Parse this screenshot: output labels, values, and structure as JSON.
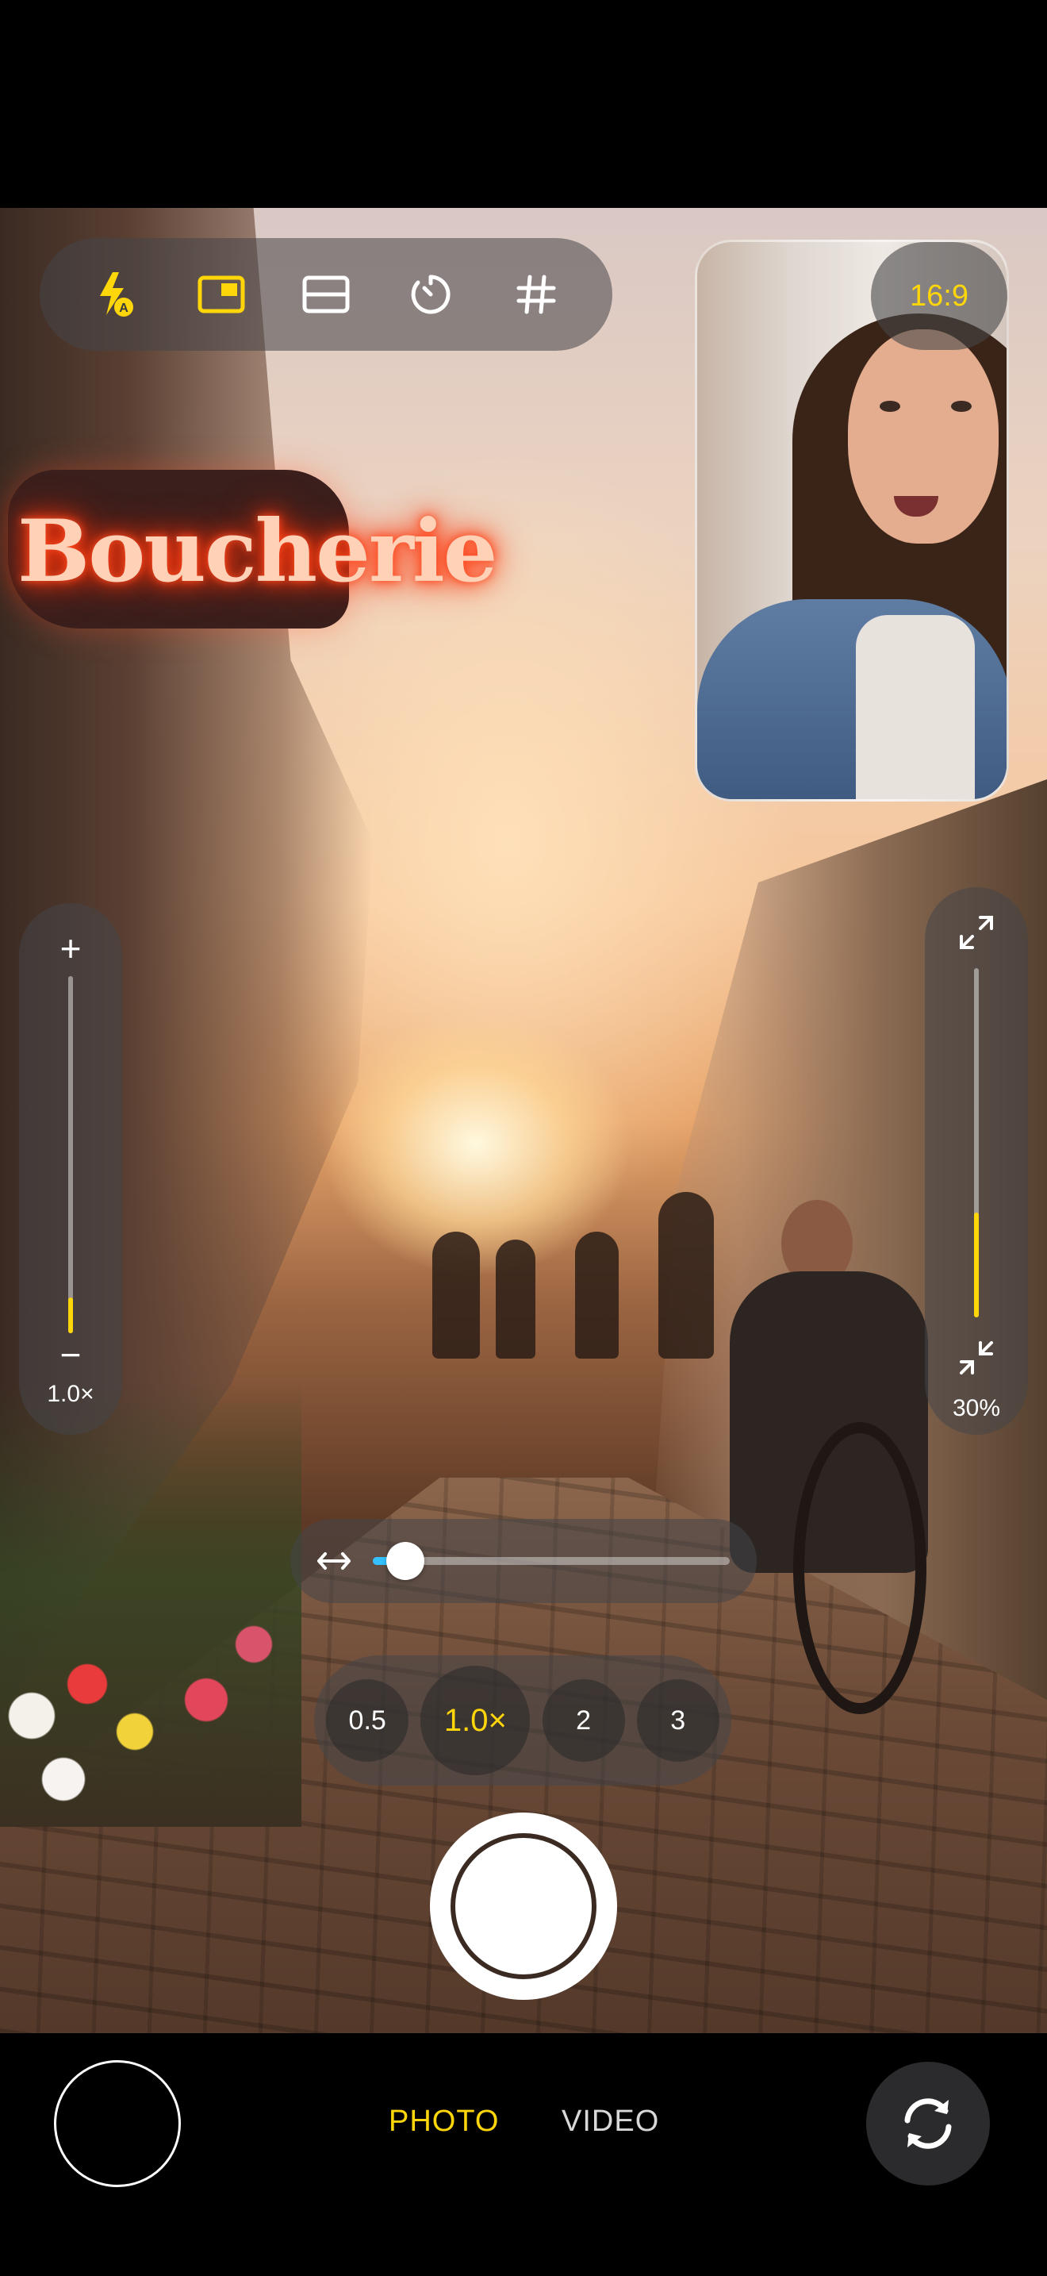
{
  "top_controls": {
    "flash_icon": "flash-auto-icon",
    "pip_icon": "picture-in-picture-icon",
    "layout_icon": "split-layout-icon",
    "timer_icon": "timer-icon",
    "grid_icon": "grid-icon",
    "active_color": "#ffd60a"
  },
  "aspect_ratio": "16:9",
  "sign_text": "Boucherie",
  "exposure": {
    "plus": "+",
    "minus": "−",
    "value_label": "1.0×",
    "level": 0.1
  },
  "pip_size": {
    "expand_icon": "expand-icon",
    "collapse_icon": "collapse-icon",
    "value_label": "30%",
    "level": 0.3
  },
  "horizontal_slider": {
    "icon": "horizontal-arrows-icon",
    "level": 0.09,
    "fill_color": "#33c2ff"
  },
  "zoom": {
    "options": [
      "0.5",
      "1.0×",
      "2",
      "3"
    ],
    "selected_index": 1
  },
  "modes": {
    "photo": "PHOTO",
    "video": "VIDEO",
    "active": "photo"
  },
  "flip_icon": "camera-flip-icon"
}
